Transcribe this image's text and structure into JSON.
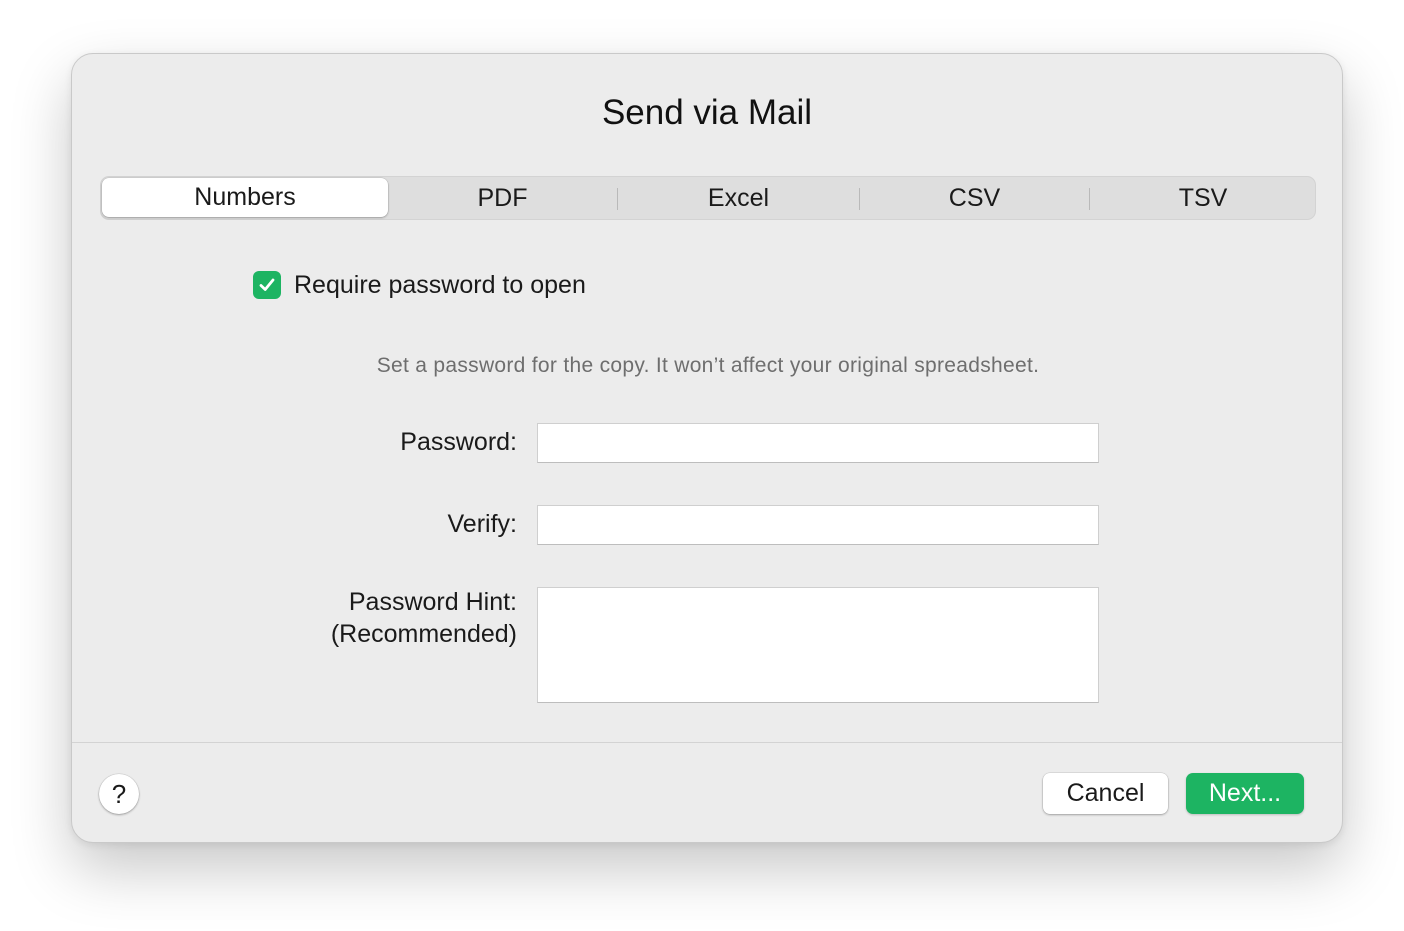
{
  "dialog": {
    "title": "Send via Mail"
  },
  "tabs": [
    {
      "label": "Numbers",
      "selected": true
    },
    {
      "label": "PDF",
      "selected": false
    },
    {
      "label": "Excel",
      "selected": false
    },
    {
      "label": "CSV",
      "selected": false
    },
    {
      "label": "TSV",
      "selected": false
    }
  ],
  "password_section": {
    "require_checkbox_label": "Require password to open",
    "require_checked": true,
    "info_text": "Set a password for the copy. It won’t affect your original spreadsheet.",
    "password_label": "Password:",
    "password_value": "",
    "verify_label": "Verify:",
    "verify_value": "",
    "hint_label_line1": "Password Hint:",
    "hint_label_line2": "(Recommended)",
    "hint_value": ""
  },
  "footer": {
    "help_label": "?",
    "cancel_label": "Cancel",
    "next_label": "Next..."
  },
  "colors": {
    "accent": "#1db462",
    "dialog_bg": "#ececec",
    "info_text": "#6e6e6e"
  },
  "icons": {
    "checkbox": "checkmark-icon",
    "help": "question-mark-icon"
  }
}
